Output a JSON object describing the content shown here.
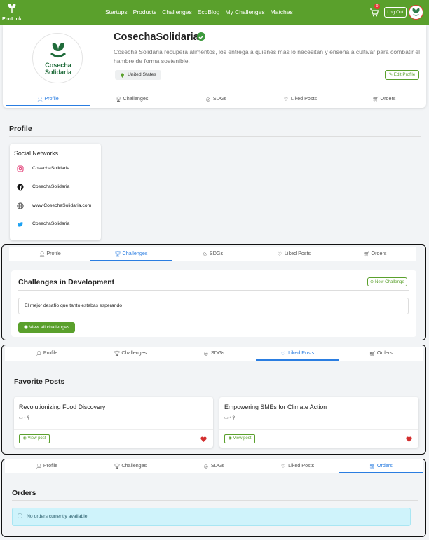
{
  "nav": {
    "logo_text": "EcoLink",
    "links": [
      "Startups",
      "Products",
      "Challenges",
      "EcoBlog",
      "My Challenges",
      "Matches"
    ],
    "cart_count": "0",
    "logout": "Log Out",
    "accent": "#5aa02c"
  },
  "profile": {
    "brand_line1": "Cosecha",
    "brand_line2": "Solidaria",
    "name": "CosechaSolidaria",
    "description": "Cosecha Solidaria recupera alimentos, los entrega a quienes más lo necesitan y enseña a cultivar para combatir el hambre de forma sostenible.",
    "country": "United States",
    "edit_label": "Edit Profile"
  },
  "tabs": [
    "Profile",
    "Challenges",
    "SDGs",
    "Liked Posts",
    "Orders"
  ],
  "profile_section": {
    "title": "Profile",
    "social_title": "Social Networks",
    "socials": [
      {
        "icon": "instagram-icon",
        "label": "CosechaSolidaria"
      },
      {
        "icon": "facebook-icon",
        "label": "CosechaSolidaria"
      },
      {
        "icon": "globe-icon",
        "label": "www.CosechaSolidaria.com"
      },
      {
        "icon": "twitter-icon",
        "label": "CosechaSolidaria"
      }
    ]
  },
  "challenges_section": {
    "title": "Challenges in Development",
    "new_label": "New Challenge",
    "item": "El mejor desafío que tanto estabas esperando",
    "view_all": "View all challenges"
  },
  "liked_section": {
    "title": "Favorite Posts",
    "posts": [
      {
        "title": "Revolutionizing Food Discovery",
        "view": "View post"
      },
      {
        "title": "Empowering SMEs for Climate Action",
        "view": "View post"
      }
    ]
  },
  "orders_section": {
    "title": "Orders",
    "empty": "No orders currently available."
  }
}
